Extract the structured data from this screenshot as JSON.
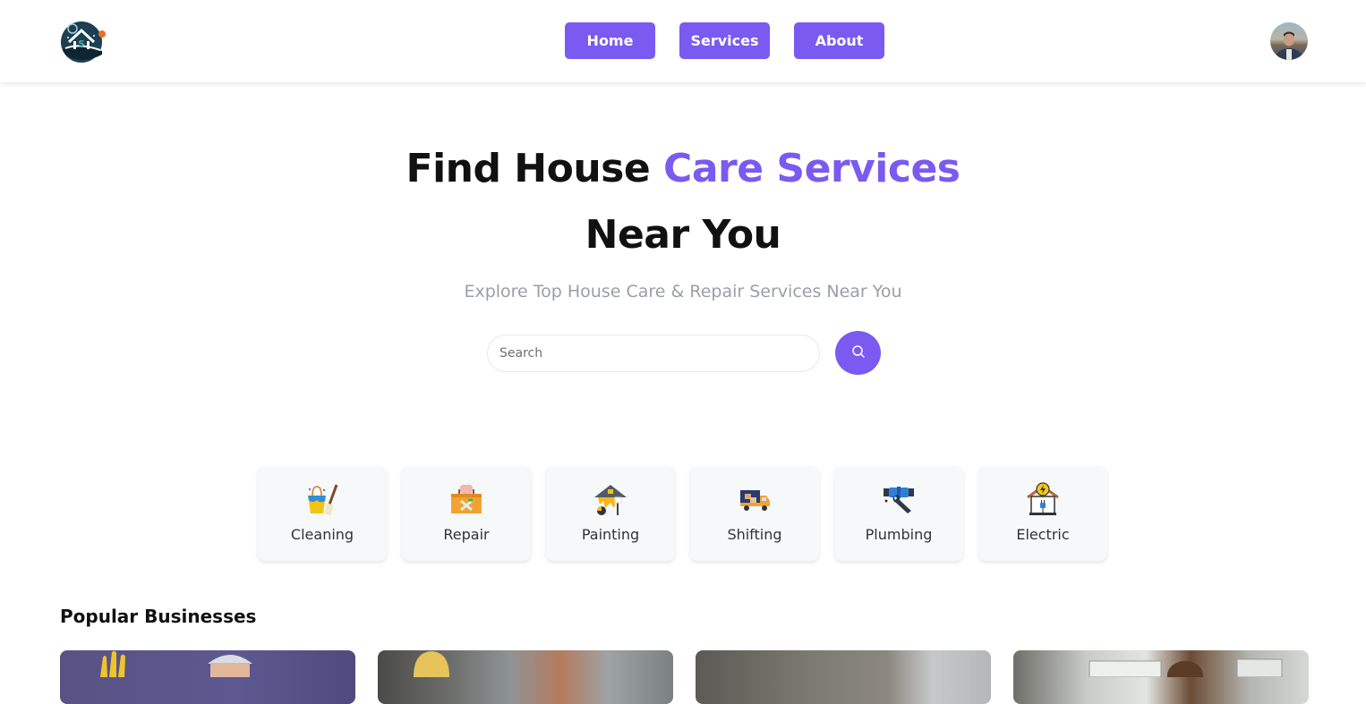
{
  "header": {
    "logo_alt": "house-care-logo",
    "nav": [
      {
        "label": "Home"
      },
      {
        "label": "Services"
      },
      {
        "label": "About"
      }
    ],
    "avatar": "user-avatar"
  },
  "hero": {
    "title_part1": "Find House ",
    "title_accent": "Care Services",
    "title_line2": "Near You",
    "subtitle": "Explore Top House Care & Repair Services Near You",
    "search_placeholder": "Search",
    "search_value": ""
  },
  "categories": [
    {
      "label": "Cleaning",
      "icon": "cleaning-icon"
    },
    {
      "label": "Repair",
      "icon": "toolbox-icon"
    },
    {
      "label": "Painting",
      "icon": "paint-house-icon"
    },
    {
      "label": "Shifting",
      "icon": "truck-icon"
    },
    {
      "label": "Plumbing",
      "icon": "pipe-wrench-icon"
    },
    {
      "label": "Electric",
      "icon": "electric-house-icon"
    }
  ],
  "popular": {
    "title": "Popular Businesses"
  },
  "colors": {
    "accent": "#7a5af0",
    "subtitle": "#9a9ea6",
    "card_bg": "#f7f8fa"
  }
}
